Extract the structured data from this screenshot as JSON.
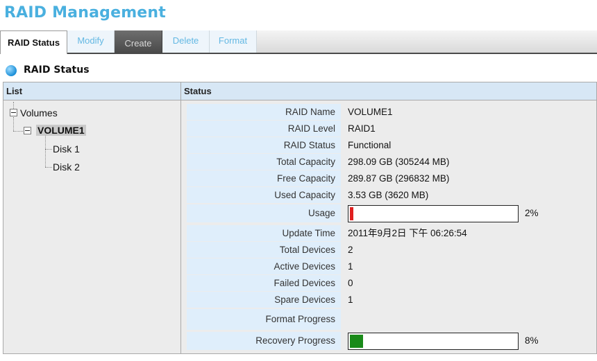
{
  "page": {
    "title": "RAID Management"
  },
  "tabs": [
    {
      "label": "RAID Status",
      "state": "active"
    },
    {
      "label": "Modify",
      "state": "link"
    },
    {
      "label": "Create",
      "state": "dark"
    },
    {
      "label": "Delete",
      "state": "link"
    },
    {
      "label": "Format",
      "state": "link"
    }
  ],
  "section": {
    "title": "RAID Status",
    "icon": "status-dot-icon"
  },
  "columns": {
    "list": "List",
    "status": "Status"
  },
  "tree": {
    "root": "Volumes",
    "volume": "VOLUME1",
    "disks": [
      "Disk 1",
      "Disk 2"
    ]
  },
  "status": {
    "raid_name": {
      "label": "RAID Name",
      "value": "VOLUME1"
    },
    "raid_level": {
      "label": "RAID Level",
      "value": "RAID1"
    },
    "raid_status": {
      "label": "RAID Status",
      "value": "Functional"
    },
    "total_capacity": {
      "label": "Total Capacity",
      "value": "298.09 GB (305244 MB)"
    },
    "free_capacity": {
      "label": "Free Capacity",
      "value": "289.87 GB (296832 MB)"
    },
    "used_capacity": {
      "label": "Used Capacity",
      "value": "3.53 GB (3620 MB)"
    },
    "usage": {
      "label": "Usage",
      "percent_text": "2%",
      "fraction": 0.02,
      "color": "#e02020"
    },
    "update_time": {
      "label": "Update Time",
      "value": "2011年9月2日 下午 06:26:54"
    },
    "total_devices": {
      "label": "Total Devices",
      "value": "2"
    },
    "active_devices": {
      "label": "Active Devices",
      "value": "1"
    },
    "failed_devices": {
      "label": "Failed Devices",
      "value": "0"
    },
    "spare_devices": {
      "label": "Spare Devices",
      "value": "1"
    },
    "format_progress": {
      "label": "Format Progress",
      "value": ""
    },
    "recovery_progress": {
      "label": "Recovery Progress",
      "percent_text": "8%",
      "fraction": 0.08,
      "color": "#1a8a1a"
    }
  },
  "colors": {
    "title": "#4ab0df",
    "header_bg": "#d7e7f5",
    "label_bg": "#dfeefb"
  }
}
